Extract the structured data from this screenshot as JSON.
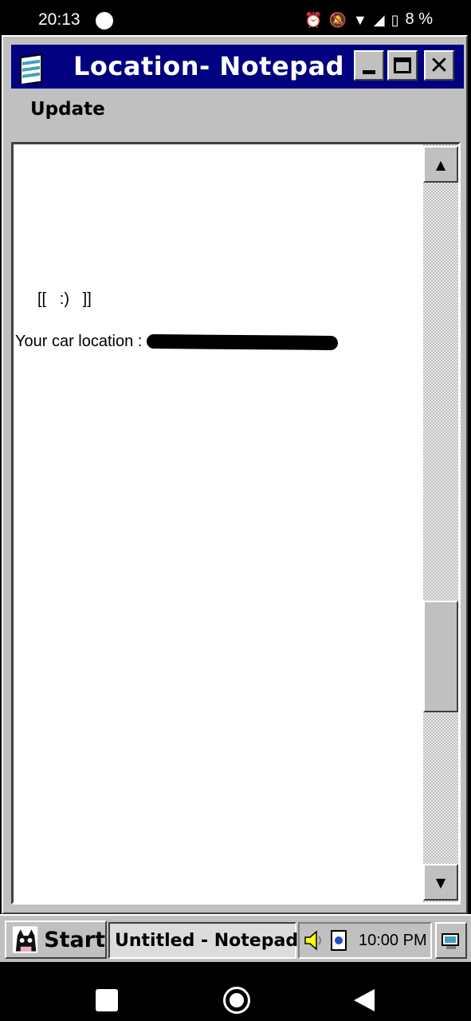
{
  "status_bar": {
    "time": "20:13",
    "battery": "8 %",
    "icons": [
      "alarm-icon",
      "dnd-off-icon",
      "wifi-icon",
      "signal-icon",
      "battery-icon"
    ]
  },
  "window": {
    "title": "Location- Notepad",
    "menu": {
      "update_label": "Update"
    },
    "content": {
      "face": "[[   :)   ]]",
      "location_label": "Your car location :"
    }
  },
  "taskbar": {
    "start_label": "Start",
    "task_label": "Untitled - Notepad",
    "clock": "10:00 PM"
  },
  "colors": {
    "titlebar": "#000080",
    "chrome": "#c0c0c0"
  }
}
